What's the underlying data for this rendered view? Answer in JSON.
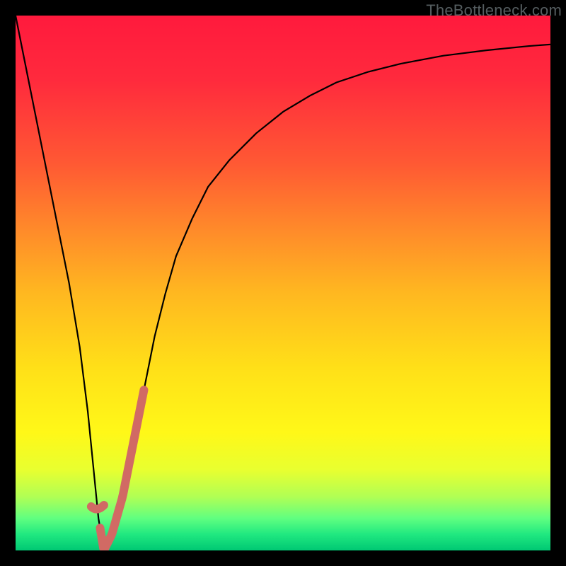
{
  "watermark": "TheBottleneck.com",
  "colors": {
    "curve": "#000000",
    "highlight": "#d16a64"
  },
  "chart_data": {
    "type": "line",
    "title": "",
    "xlabel": "",
    "ylabel": "",
    "xlim": [
      0,
      100
    ],
    "ylim": [
      0,
      100
    ],
    "grid": false,
    "series": [
      {
        "name": "bottleneck-curve",
        "x": [
          0,
          2,
          4,
          6,
          8,
          10,
          12,
          13.5,
          14.5,
          15.5,
          16.5,
          18,
          20,
          22,
          24,
          26,
          28,
          30,
          33,
          36,
          40,
          45,
          50,
          55,
          60,
          66,
          72,
          80,
          88,
          96,
          100
        ],
        "values": [
          100,
          90,
          80,
          70,
          60,
          50,
          38,
          26,
          16,
          6,
          0,
          3,
          10,
          20,
          30,
          40,
          48,
          55,
          62,
          68,
          73,
          78,
          82,
          85,
          87.5,
          89.5,
          91,
          92.5,
          93.5,
          94.3,
          94.6
        ]
      }
    ],
    "highlight_segment": {
      "series": "bottleneck-curve",
      "x_range": [
        15.8,
        24
      ],
      "note": "thick salmon stroke over the indicated x range"
    }
  }
}
